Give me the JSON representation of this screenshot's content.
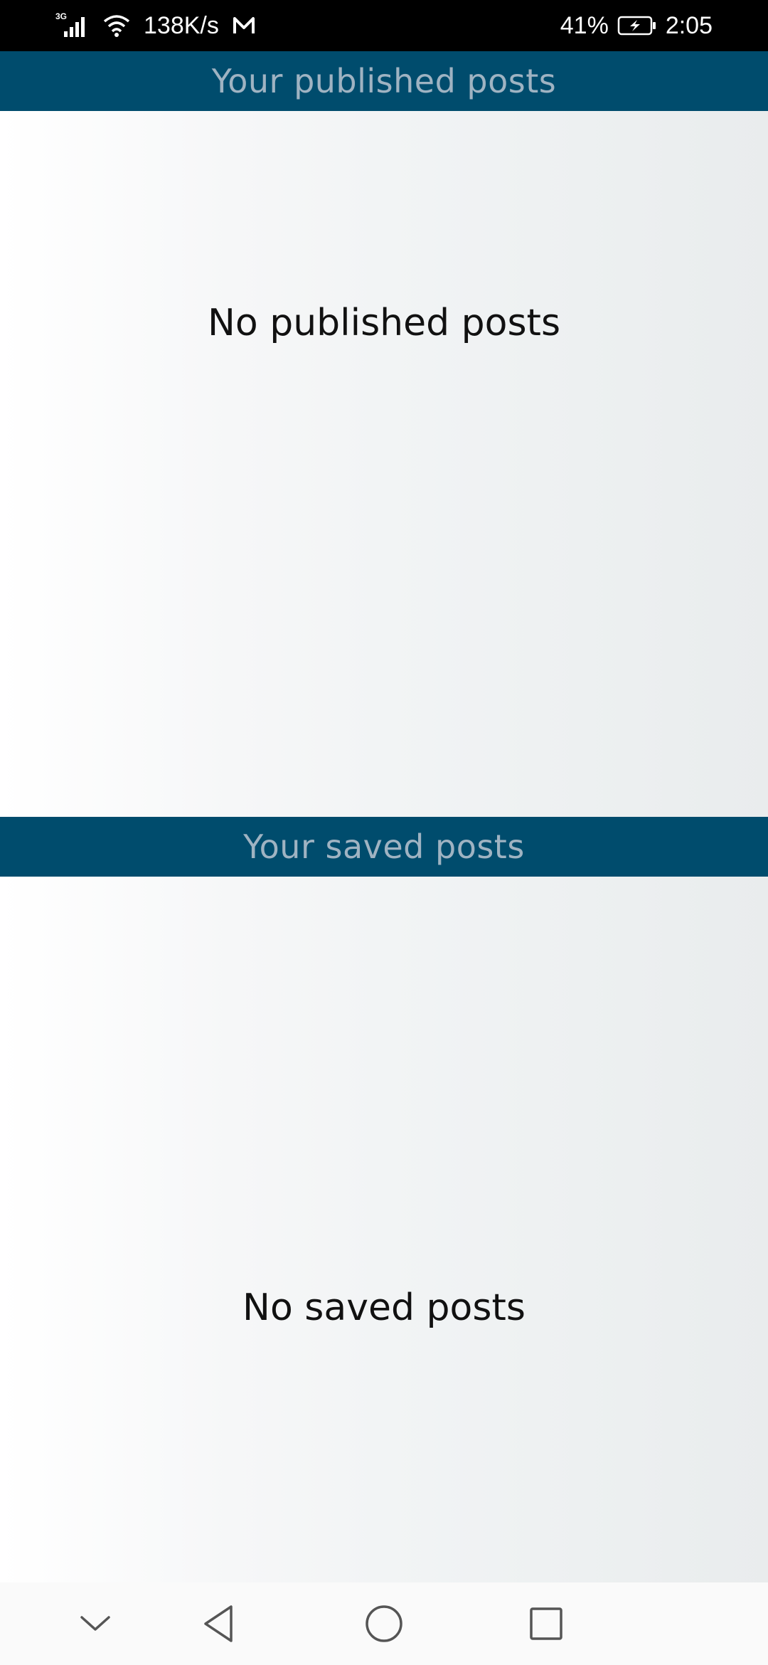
{
  "status_bar": {
    "network_type": "3G",
    "speed": "138K/s",
    "battery": "41%",
    "time": "2:05",
    "icons": [
      "signal-icon",
      "wifi-icon",
      "mail-app-icon",
      "battery-charging-icon"
    ]
  },
  "published": {
    "header": "Your published posts",
    "empty_message": "No published posts"
  },
  "saved": {
    "header": "Your saved posts",
    "empty_message": "No saved posts"
  },
  "nav": {
    "icons": [
      "collapse-chevron-icon",
      "back-triangle-icon",
      "home-circle-icon",
      "recents-square-icon"
    ]
  },
  "colors": {
    "header_bg": "#004c6d",
    "header_text": "#9fb3c2",
    "status_bar_bg": "#000000",
    "nav_bar_bg": "#fafafa"
  }
}
